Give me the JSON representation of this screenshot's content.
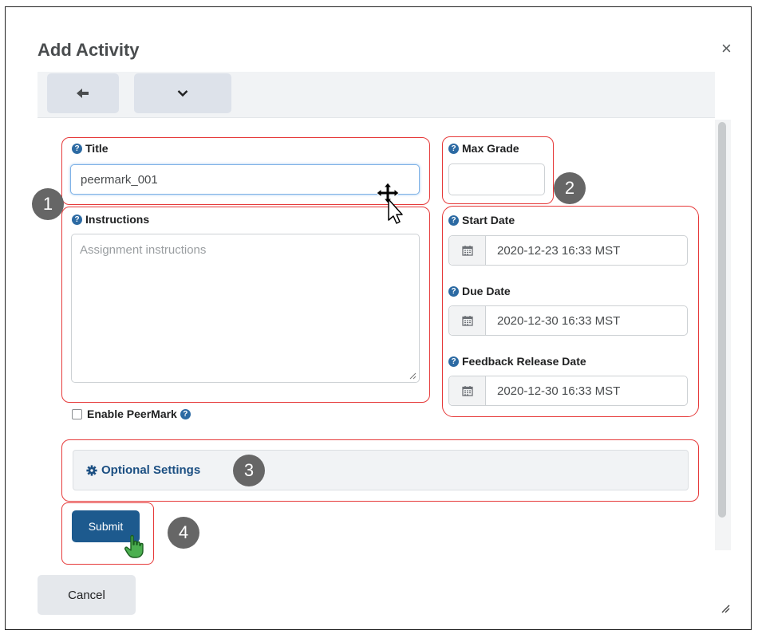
{
  "dialog": {
    "title": "Add Activity",
    "close_label": "×"
  },
  "toolbar": {
    "back_icon": "arrow-left-icon",
    "expand_icon": "chevron-down-icon"
  },
  "form": {
    "title_label": "Title",
    "title_value": "peermark_001",
    "instructions_label": "Instructions",
    "instructions_placeholder": "Assignment instructions",
    "max_grade_label": "Max Grade",
    "max_grade_value": "",
    "start_date_label": "Start Date",
    "start_date_value": "2020-12-23 16:33 MST",
    "due_date_label": "Due Date",
    "due_date_value": "2020-12-30 16:33 MST",
    "feedback_date_label": "Feedback Release Date",
    "feedback_date_value": "2020-12-30 16:33 MST",
    "enable_peermark_label": "Enable PeerMark",
    "enable_peermark_checked": false,
    "optional_settings_label": "Optional Settings",
    "submit_label": "Submit",
    "cancel_label": "Cancel"
  },
  "callouts": [
    "1",
    "2",
    "3",
    "4"
  ],
  "colors": {
    "highlight": "#e63a3a",
    "link": "#1b4f82",
    "primary_button": "#1d5a8e",
    "callout_badge": "#666666"
  }
}
